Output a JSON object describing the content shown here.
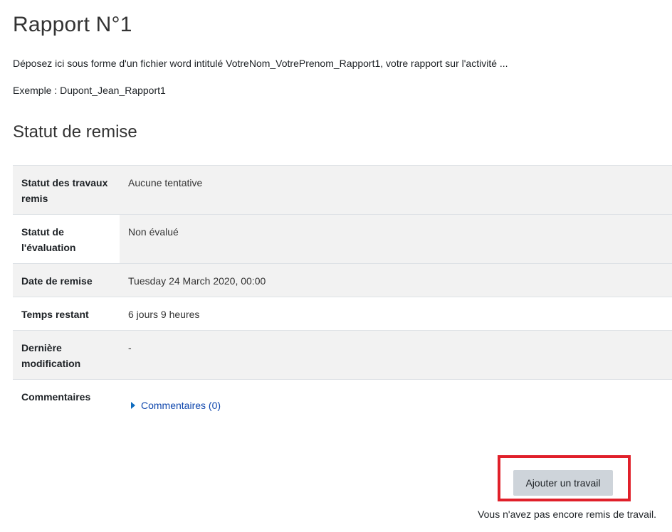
{
  "assignment": {
    "title": "Rapport N°1",
    "intro": "Déposez ici sous forme d'un fichier word intitulé VotreNom_VotrePrenom_Rapport1, votre rapport sur l'activité ...",
    "example": "Exemple : Dupont_Jean_Rapport1"
  },
  "submission_status": {
    "heading": "Statut de remise",
    "rows": [
      {
        "label": "Statut des travaux remis",
        "value": "Aucune tentative"
      },
      {
        "label": "Statut de l'évaluation",
        "value": "Non évalué"
      },
      {
        "label": "Date de remise",
        "value": "Tuesday 24 March 2020, 00:00"
      },
      {
        "label": "Temps restant",
        "value": "6 jours 9 heures"
      },
      {
        "label": "Dernière modification",
        "value": "-"
      },
      {
        "label": "Commentaires",
        "value": "Commentaires (0)"
      }
    ]
  },
  "actions": {
    "add_work_label": "Ajouter un travail",
    "not_submitted_text": "Vous n'avez pas encore remis de travail."
  },
  "colors": {
    "link": "#0f47ad",
    "highlight": "#e0202a",
    "button_bg": "#ced4da"
  }
}
